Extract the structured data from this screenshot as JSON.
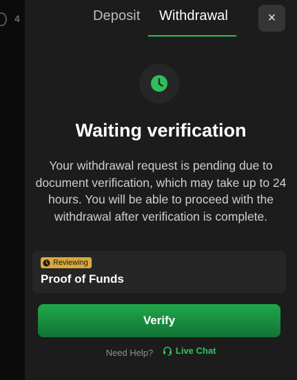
{
  "backdrop": {
    "fragment_char": "4"
  },
  "tabs": [
    {
      "label": "Deposit",
      "active": false
    },
    {
      "label": "Withdrawal",
      "active": true
    }
  ],
  "close": {
    "label": "×",
    "icon": "close-icon"
  },
  "status": {
    "icon": "clock-icon",
    "icon_color": "#2fbf5a",
    "title": "Waiting verification",
    "description": "Your withdrawal request is pending due to document verification, which may take up to 24 hours. You will be able to proceed with the withdrawal after verification is complete."
  },
  "card": {
    "badge": {
      "label": "Reviewing",
      "icon": "clock-icon",
      "color": "#d9a93a"
    },
    "title": "Proof of Funds"
  },
  "verify_button": {
    "label": "Verify",
    "color": "#1fa84a"
  },
  "help": {
    "text": "Need Help?",
    "link_icon": "headset-icon",
    "link_label": "Live Chat",
    "link_color": "#2fc45c"
  }
}
